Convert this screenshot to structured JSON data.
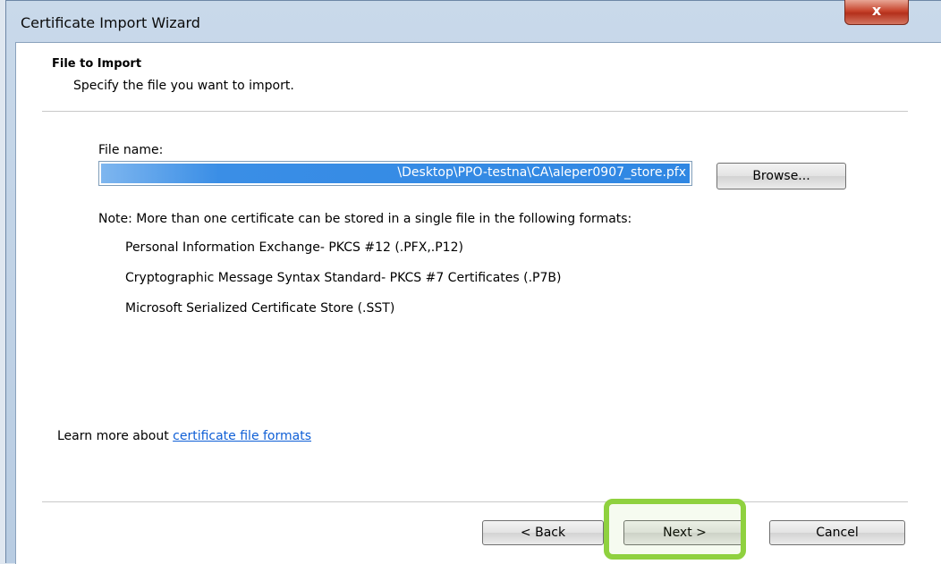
{
  "window": {
    "title": "Certificate Import Wizard",
    "close_label": "x"
  },
  "header": {
    "title": "File to Import",
    "subtitle": "Specify the file you want to import."
  },
  "file": {
    "label": "File name:",
    "value": "\\Desktop\\PPO-testna\\CA\\aleper0907_store.pfx",
    "browse_label": "Browse..."
  },
  "note": {
    "text": "Note:  More than one certificate can be stored in a single file in the following formats:",
    "formats": [
      "Personal Information Exchange- PKCS #12 (.PFX,.P12)",
      "Cryptographic Message Syntax Standard- PKCS #7 Certificates (.P7B)",
      "Microsoft Serialized Certificate Store (.SST)"
    ]
  },
  "learn_more": {
    "prefix": "Learn more about ",
    "link": "certificate file formats"
  },
  "buttons": {
    "back": "< Back",
    "next": "Next >",
    "cancel": "Cancel"
  },
  "colors": {
    "highlight": "#8fd13f",
    "link": "#0f5fd6",
    "selection": "#2f87e3"
  }
}
